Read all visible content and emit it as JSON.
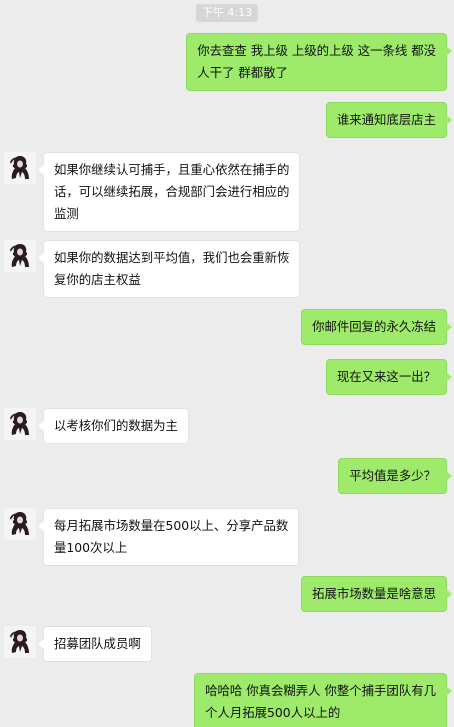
{
  "timestamp": "下午 4:13",
  "messages": [
    {
      "side": "out",
      "lines": [
        "你去查查 我上级 上级的上级  这一条线 都没",
        "人干了 群都散了"
      ]
    },
    {
      "side": "out",
      "lines": [
        "谁来通知底层店主"
      ]
    },
    {
      "side": "in",
      "lines": [
        "如果你继续认可捕手，且重心依然在捕手的",
        "话，可以继续拓展，合规部门会进行相应的",
        "监测"
      ]
    },
    {
      "side": "in",
      "lines": [
        "如果你的数据达到平均值，我们也会重新恢",
        "复你的店主权益"
      ]
    },
    {
      "side": "out",
      "lines": [
        "你邮件回复的永久冻结"
      ]
    },
    {
      "side": "out",
      "lines": [
        "现在又来这一出？"
      ]
    },
    {
      "side": "in",
      "lines": [
        "以考核你们的数据为主"
      ]
    },
    {
      "side": "out",
      "lines": [
        "平均值是多少？"
      ]
    },
    {
      "side": "in",
      "lines": [
        "每月拓展市场数量在500以上、分享产品数",
        "量100次以上"
      ]
    },
    {
      "side": "out",
      "lines": [
        "拓展市场数量是啥意思"
      ]
    },
    {
      "side": "in",
      "lines": [
        "招募团队成员啊"
      ]
    },
    {
      "side": "out",
      "lines": [
        "哈哈哈  你真会糊弄人   你整个捕手团队有几",
        "个人月拓展500人以上的"
      ]
    }
  ]
}
